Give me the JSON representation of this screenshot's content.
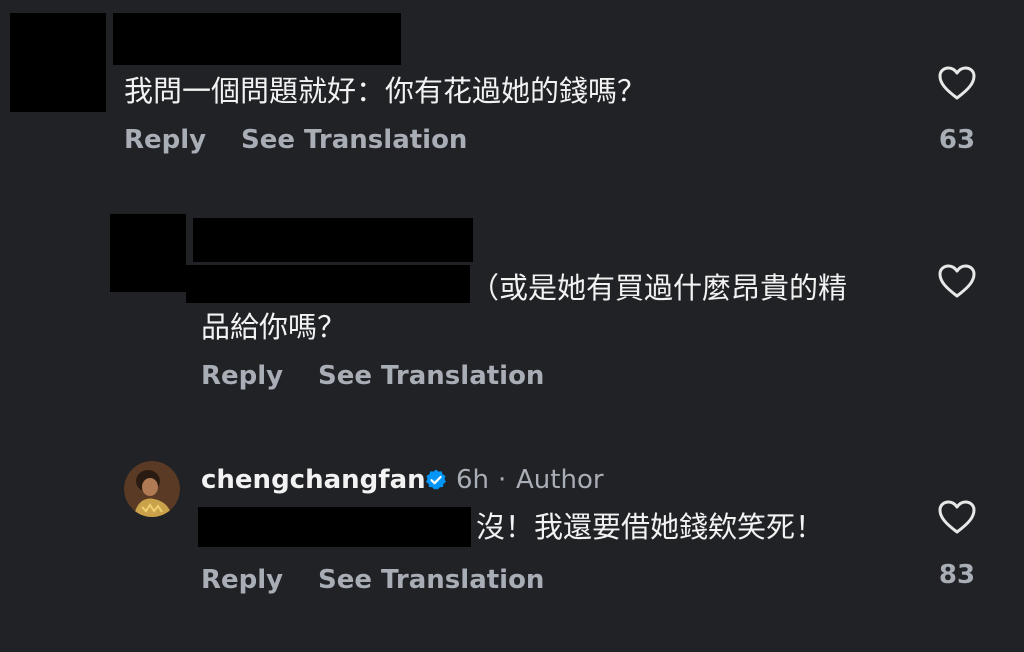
{
  "comments": [
    {
      "text": "我問一個問題就好：你有花過她的錢嗎？",
      "reply_label": "Reply",
      "translate_label": "See Translation",
      "like_count": "63",
      "like_icon": "heart-icon"
    },
    {
      "text_line1": "（或是她有買過什麼昂貴的精",
      "text_line2": "品給你嗎？",
      "reply_label": "Reply",
      "translate_label": "See Translation",
      "like_icon": "heart-icon"
    },
    {
      "username": "chengchangfan",
      "verified_icon": "verified-badge-icon",
      "time": "6h",
      "separator": "·",
      "author_label": "Author",
      "text": "沒！我還要借她錢欸笑死！",
      "reply_label": "Reply",
      "translate_label": "See Translation",
      "like_count": "83",
      "like_icon": "heart-icon"
    }
  ],
  "colors": {
    "background": "#202226",
    "text": "#f2f2f2",
    "secondary": "#a9adb5",
    "verified": "#0095f6",
    "redaction": "#000000"
  }
}
